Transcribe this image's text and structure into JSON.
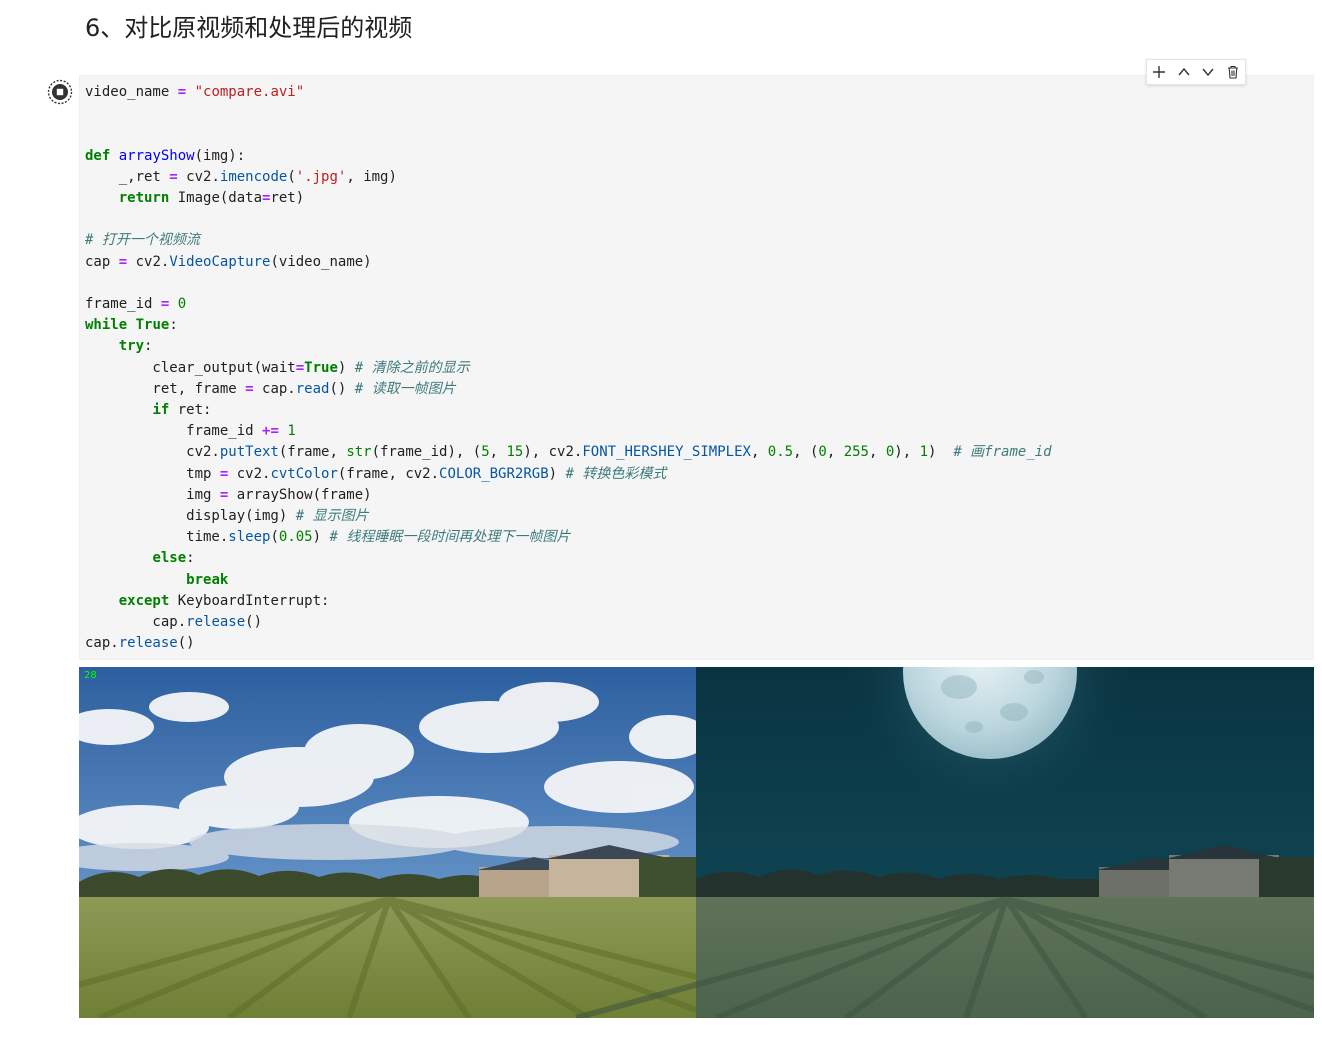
{
  "heading": "6、对比原视频和处理后的视频",
  "toolbar": {
    "add_icon": "plus-icon",
    "up_icon": "chevron-up-icon",
    "down_icon": "chevron-down-icon",
    "delete_icon": "trash-icon"
  },
  "cell": {
    "run_state_icon": "stop-circle-icon",
    "code_lines": [
      "video_name = \"compare.avi\"",
      "",
      "",
      "def arrayShow(img):",
      "    _,ret = cv2.imencode('.jpg', img)",
      "    return Image(data=ret)",
      "",
      "# 打开一个视频流",
      "cap = cv2.VideoCapture(video_name)",
      "",
      "frame_id = 0",
      "while True:",
      "    try:",
      "        clear_output(wait=True) # 清除之前的显示",
      "        ret, frame = cap.read() # 读取一帧图片",
      "        if ret:",
      "            frame_id += 1",
      "            cv2.putText(frame, str(frame_id), (5, 15), cv2.FONT_HERSHEY_SIMPLEX, 0.5, (0, 255, 0), 1)  # 画frame_id",
      "            tmp = cv2.cvtColor(frame, cv2.COLOR_BGR2RGB) # 转换色彩模式",
      "            img = arrayShow(frame)",
      "            display(img) # 显示图片",
      "            time.sleep(0.05) # 线程睡眠一段时间再处理下一帧图片",
      "        else:",
      "            break",
      "    except KeyboardInterrupt:",
      "        cap.release()",
      "cap.release()"
    ]
  },
  "output": {
    "frame_counter": "28",
    "left_frame": "day-field-sky-image",
    "right_frame": "night-moon-field-image",
    "colors": {
      "counter_green": "#00ff00",
      "sky_blue": "#3f6fa8",
      "night_teal": "#0d3a48",
      "grass_green": "#7e8c45"
    }
  }
}
